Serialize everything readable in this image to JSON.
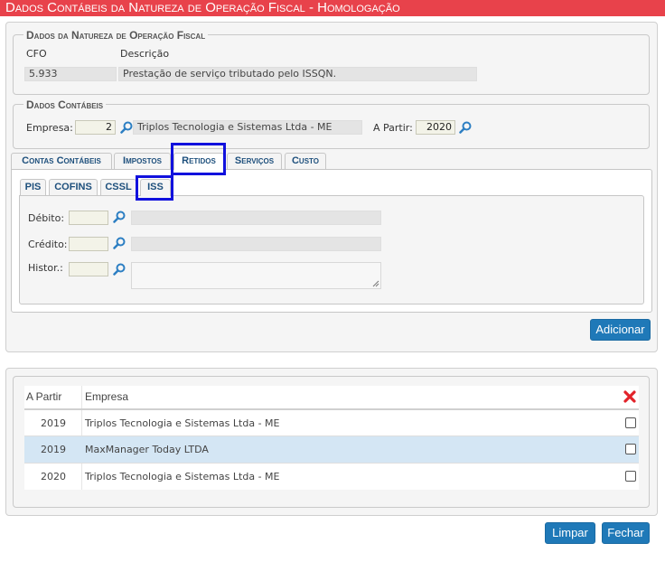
{
  "title": "Dados Contábeis da Natureza de Operação Fiscal  - Homologação",
  "natureza": {
    "legend": "Dados da Natureza de Operação Fiscal",
    "cfo_label": "CFO",
    "descricao_label": "Descrição",
    "cfo_value": "5.933",
    "descricao_value": "Prestação de serviço tributado pelo ISSQN."
  },
  "contabeis": {
    "legend": "Dados Contábeis",
    "empresa_label": "Empresa:",
    "empresa_code": "2",
    "empresa_name": "Triplos Tecnologia e Sistemas Ltda - ME",
    "a_partir_label": "A Partir:",
    "a_partir_value": "2020"
  },
  "tabs": [
    "Contas Contábeis",
    "Impostos",
    "Retidos",
    "Serviços",
    "Custo"
  ],
  "subtabs": [
    "PIS",
    "COFINS",
    "CSSL",
    "ISS"
  ],
  "form": {
    "debito_label": "Débito:",
    "credito_label": "Crédito:",
    "histor_label": "Histor.:"
  },
  "buttons": {
    "adicionar": "Adicionar",
    "limpar": "Limpar",
    "fechar": "Fechar"
  },
  "table": {
    "col_a_partir": "A Partir",
    "col_empresa": "Empresa",
    "rows": [
      {
        "year": "2019",
        "empresa": "Triplos Tecnologia e Sistemas Ltda - ME"
      },
      {
        "year": "2019",
        "empresa": "MaxManager Today LTDA"
      },
      {
        "year": "2020",
        "empresa": "Triplos Tecnologia e Sistemas Ltda - ME"
      }
    ]
  },
  "colors": {
    "title_bg": "#e8424b",
    "button_bg": "#1f79b8",
    "highlight_row": "#d4e6f4",
    "annotation_box": "#1111dd",
    "delete_icon": "#e2232a"
  },
  "icons": {
    "search": "magnifier-icon",
    "delete_all": "red-x-icon"
  }
}
